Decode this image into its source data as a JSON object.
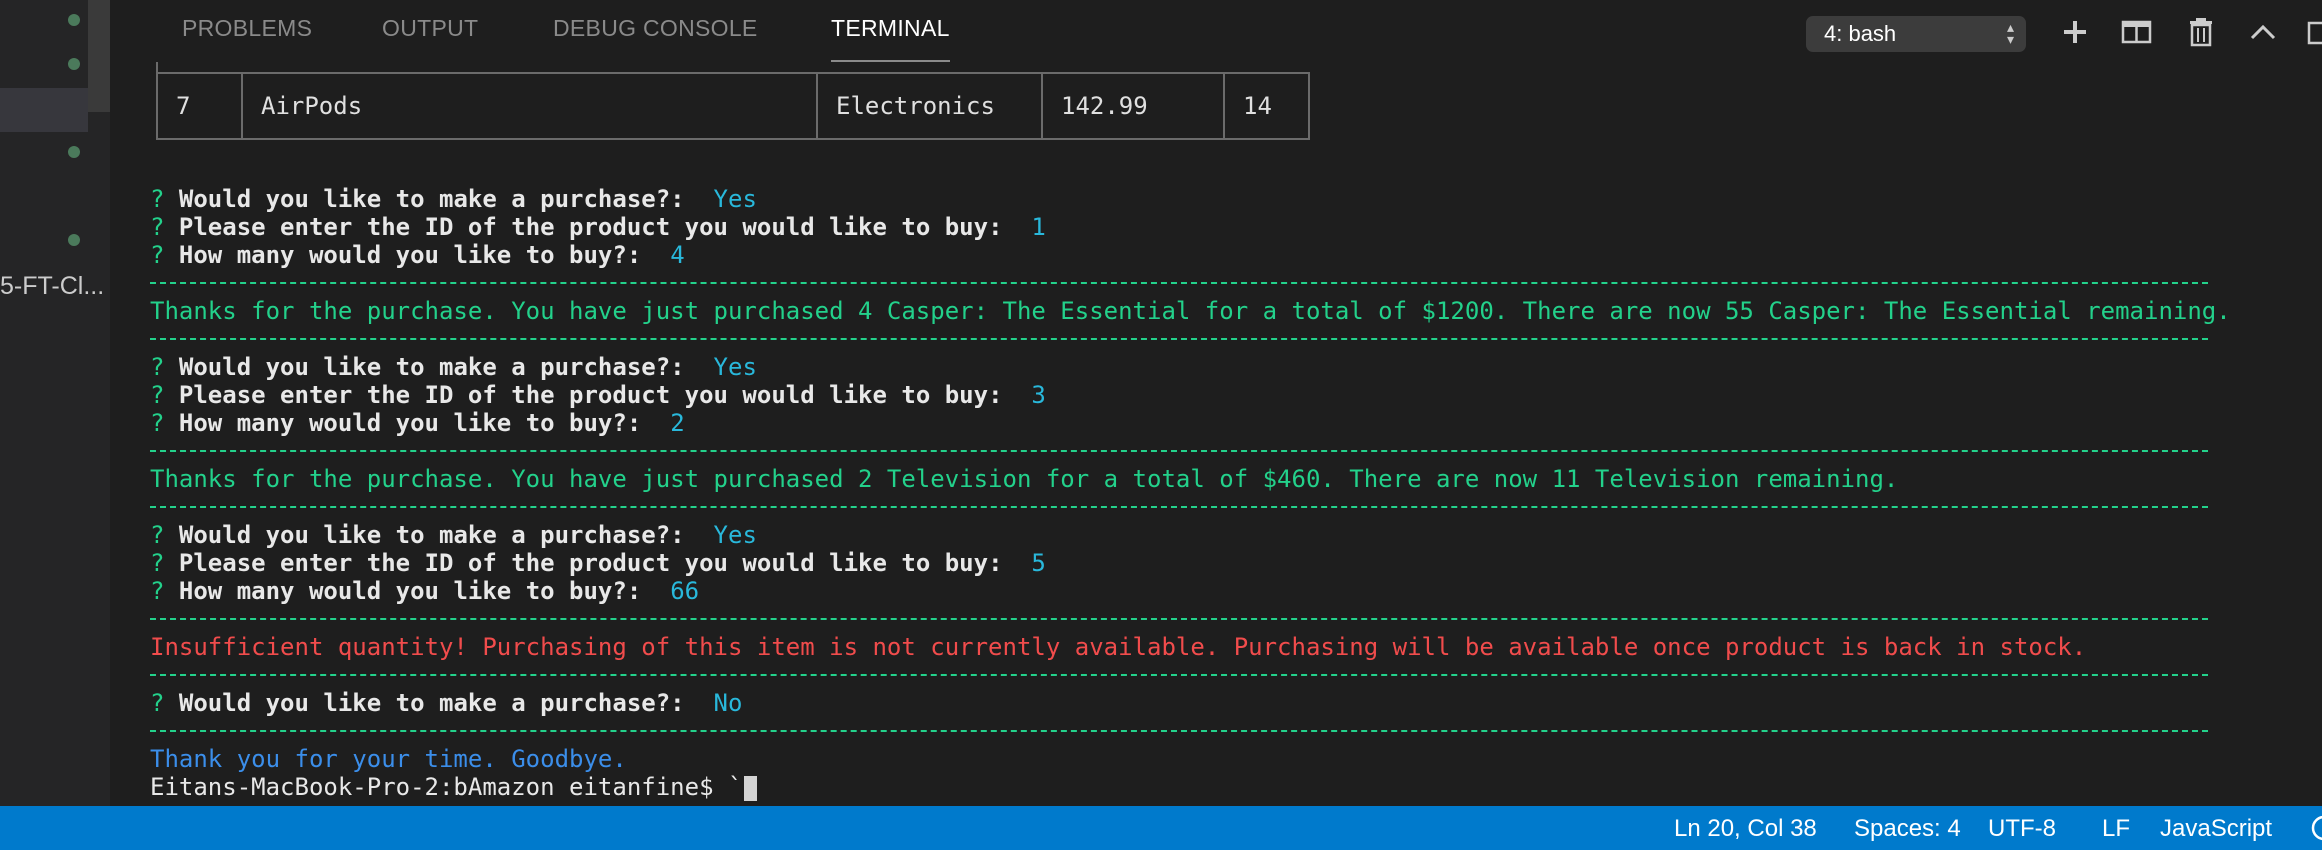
{
  "sidebar": {
    "truncated_label": "5-FT-Cl..."
  },
  "panel": {
    "tabs": [
      {
        "label": "PROBLEMS"
      },
      {
        "label": "OUTPUT"
      },
      {
        "label": "DEBUG CONSOLE"
      },
      {
        "label": "TERMINAL"
      }
    ],
    "active_tab": "TERMINAL",
    "terminal_selector": "4: bash",
    "icons": [
      "plus-icon",
      "split-terminal-icon",
      "trash-icon",
      "chevron-up-icon",
      "maximize-icon"
    ]
  },
  "terminal": {
    "table_row": {
      "id": "7",
      "name": "AirPods",
      "department": "Electronics",
      "price": "142.99",
      "stock": "14"
    },
    "prompt_mark": "?",
    "q_purchase": "Would you like to make a purchase?:",
    "q_id": "Please enter the ID of the product you would like to buy:",
    "q_qty": "How many would you like to buy?:",
    "rounds": [
      {
        "purchase": "Yes",
        "id": "1",
        "qty": "4"
      },
      {
        "purchase": "Yes",
        "id": "3",
        "qty": "2"
      },
      {
        "purchase": "Yes",
        "id": "5",
        "qty": "66"
      },
      {
        "purchase": "No"
      }
    ],
    "msg1": "Thanks for the purchase. You have just purchased 4 Casper: The Essential for a total of $1200. There are now 55 Casper: The Essential remaining.",
    "msg2": "Thanks for the purchase. You have just purchased 2 Television for a total of $460. There are now 11 Television remaining.",
    "msg3": "Insufficient quantity! Purchasing of this item is not currently available. Purchasing will be available once product is back in stock.",
    "goodbye": "Thank you for your time. Goodbye.",
    "shell_prompt": "Eitans-MacBook-Pro-2:bAmazon eitanfine$ `"
  },
  "statusbar": {
    "position": "Ln 20, Col 38",
    "spaces": "Spaces: 4",
    "encoding": "UTF-8",
    "eol": "LF",
    "language": "JavaScript"
  },
  "colors": {
    "statusbar": "#007acc",
    "success": "#23d18b",
    "error": "#f14c4c",
    "answer": "#29b8db",
    "info": "#3b8eea"
  }
}
